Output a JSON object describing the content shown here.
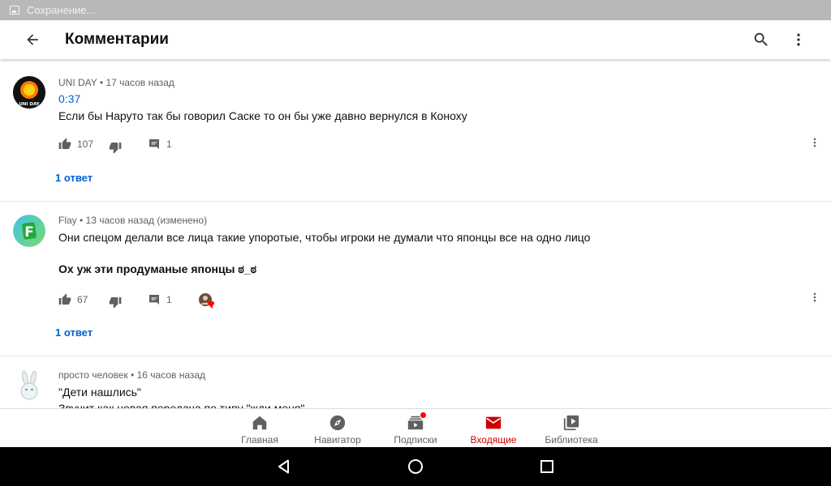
{
  "status_bar": {
    "text": "Сохранение..."
  },
  "app_bar": {
    "title": "Комментарии"
  },
  "comments": [
    {
      "author": "UNI DAY",
      "time": "17 часов назад",
      "timecode": "0:37",
      "lines": [
        "Если бы Наруто так бы говорил Саске то он бы уже давно вернулся в Коноху"
      ],
      "likes": "107",
      "replies_count": "1",
      "replies_link": "1 ответ",
      "avatar_text": "UNI DAY"
    },
    {
      "author": "Flay",
      "time": "13 часов назад (изменено)",
      "lines": [
        "Они спецом делали все лица такие упоротые, чтобы игроки не думали что японцы все на одно лицо",
        "Ох уж эти продуманые японцы ಠ_ಠ"
      ],
      "likes": "67",
      "replies_count": "1",
      "replies_link": "1 ответ",
      "avatar_letter": "F"
    },
    {
      "author": "просто человек",
      "time": "16 часов назад",
      "lines": [
        "\"Дети нашлись\"",
        "Звучит как новая передача по типу \"жди меня\""
      ]
    }
  ],
  "bottom_nav": [
    {
      "label": "Главная",
      "icon": "home-icon"
    },
    {
      "label": "Навигатор",
      "icon": "compass-icon"
    },
    {
      "label": "Подписки",
      "icon": "subscriptions-icon"
    },
    {
      "label": "Входящие",
      "icon": "inbox-icon"
    },
    {
      "label": "Библиотека",
      "icon": "library-icon"
    }
  ],
  "colors": {
    "accent": "#065fd4",
    "active_nav": "#cc0000",
    "notification": "#ff0000"
  }
}
